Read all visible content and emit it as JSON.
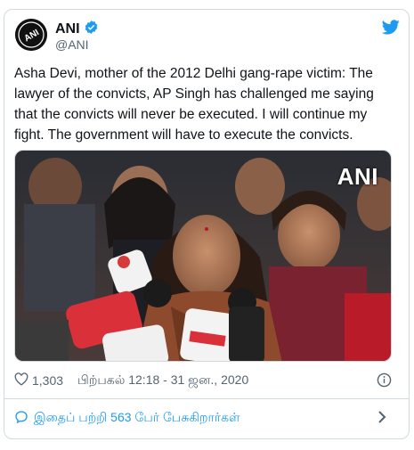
{
  "tweet": {
    "author_name": "ANI",
    "author_handle": "@ANI",
    "avatar_text": "ANI",
    "text": "Asha Devi, mother of the 2012 Delhi gang-rape victim: The lawyer of the convicts, AP Singh has challenged me saying that the convicts will never be executed. I will continue my fight. The government will have to execute the convicts.",
    "media_watermark": "ANI",
    "like_count": "1,303",
    "timestamp": "பிற்பகல் 12:18 - 31 ஜன., 2020",
    "reply_prompt": "இதைப் பற்றி 563 பேர் பேசுகிறார்கள்"
  },
  "colors": {
    "accent": "#1d9bf0",
    "text": "#0f1419",
    "muted": "#536471",
    "border": "#cfd9de"
  },
  "icons": {
    "verified": "verified-badge-icon",
    "bird": "twitter-bird-icon",
    "heart": "heart-icon",
    "info": "info-icon",
    "reply": "reply-bubble-icon",
    "chevron": "chevron-right-icon"
  }
}
